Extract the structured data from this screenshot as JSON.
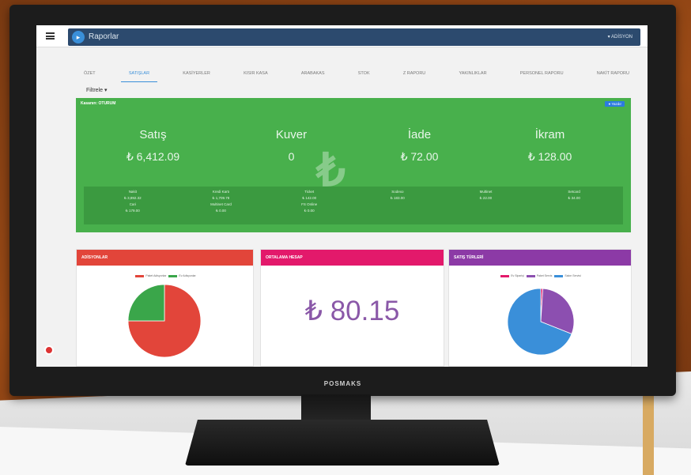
{
  "header": {
    "app_title": "Raporlar",
    "user_label": "▾ ADİSYON"
  },
  "tabs": [
    "ÖZET",
    "SATIŞLAR",
    "KASİYERLER",
    "KISIR KASA",
    "ARABAKAS",
    "STOK",
    "Z RAPORU",
    "YAKINLIKLAR",
    "PERSONEL RAPORU",
    "NAKİT RAPORU"
  ],
  "filter_label": "Filtrele ▾",
  "summary": {
    "title": "Kasanın: OTURUM",
    "button_label": "● Yazdır",
    "metrics": [
      {
        "label": "Satış",
        "value": "₺ 6,412.09"
      },
      {
        "label": "Kuver",
        "value": "0"
      },
      {
        "label": "İade",
        "value": "₺ 72.00"
      },
      {
        "label": "İkram",
        "value": "₺ 128.00"
      }
    ],
    "breakdown": [
      [
        "Nakit",
        "Kredi Kartı",
        "Ticket",
        "Sodexo",
        "Multinet",
        "Setcard"
      ],
      [
        "₺ 3,892.32",
        "₺ 1,709.78",
        "₺ 142.00",
        "₺ 183.00",
        "₺ 22.00",
        "₺ 34.00"
      ],
      [
        "Cari",
        "Multinet Card",
        "FS Online",
        "",
        "",
        ""
      ],
      [
        "₺ 179.00",
        "₺ 0.00",
        "₺ 0.00",
        "",
        "",
        ""
      ]
    ]
  },
  "panels": [
    {
      "title": "ADİSYONLAR",
      "color": "#e2453a",
      "legend": [
        "Paket Adisyonlar",
        "Ev Adisyonlar"
      ]
    },
    {
      "title": "ORTALAMA HESAP",
      "color": "#e3196b",
      "value": "₺ 80.15"
    },
    {
      "title": "SATIŞ TÜRLERİ",
      "color": "#8c3aa6",
      "legend": [
        "Ev Siparişi",
        "Paket Servis",
        "Salon Servisi"
      ]
    }
  ],
  "chart_data": [
    {
      "type": "pie",
      "labels": [
        "Paket Adisyonlar",
        "Ev Adisyonlar"
      ],
      "values": [
        75,
        25
      ],
      "colors": [
        "#e2453a",
        "#3aa64a"
      ]
    },
    {
      "type": "pie",
      "labels": [
        "Ev Siparişi",
        "Paket Servis",
        "Salon Servisi"
      ],
      "values": [
        1,
        30,
        69
      ],
      "colors": [
        "#e3196b",
        "#8c4fb0",
        "#3a8fd9"
      ]
    }
  ],
  "brand": "POSMAKS"
}
